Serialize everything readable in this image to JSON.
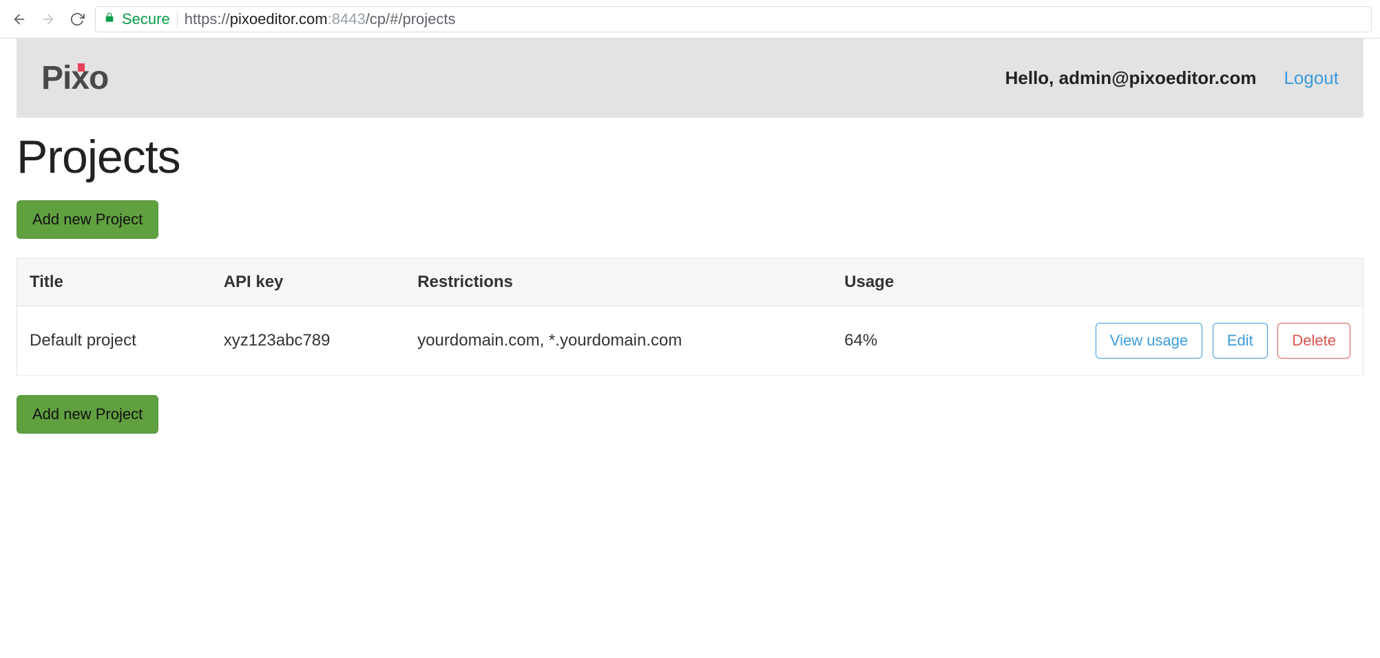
{
  "browser": {
    "secure_label": "Secure",
    "url_scheme": "https",
    "url_host": "pixoeditor.com",
    "url_port": ":8443",
    "url_path": "/cp/#/projects"
  },
  "header": {
    "logo_text": "Pixo",
    "greeting": "Hello, admin@pixoeditor.com",
    "logout_label": "Logout"
  },
  "page": {
    "title": "Projects",
    "add_button_label": "Add new Project"
  },
  "table": {
    "columns": {
      "title": "Title",
      "api_key": "API key",
      "restrictions": "Restrictions",
      "usage": "Usage"
    },
    "rows": [
      {
        "title": "Default project",
        "api_key": "xyz123abc789",
        "restrictions": "yourdomain.com, *.yourdomain.com",
        "usage": "64%"
      }
    ],
    "actions": {
      "view_usage": "View usage",
      "edit": "Edit",
      "delete": "Delete"
    }
  }
}
